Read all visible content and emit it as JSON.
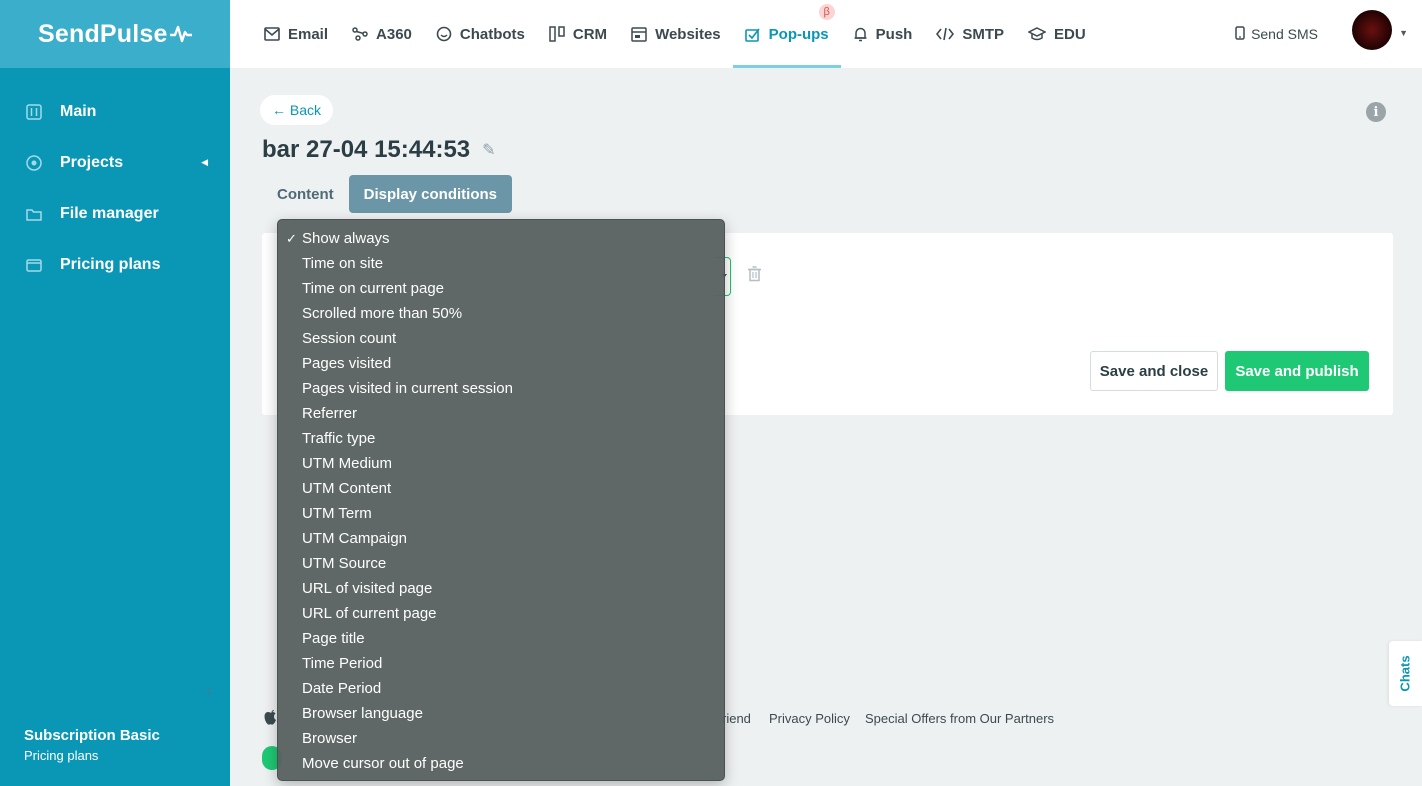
{
  "brand": {
    "name": "SendPulse"
  },
  "sidebar": {
    "items": [
      {
        "label": "Main",
        "icon": "main-icon"
      },
      {
        "label": "Projects",
        "icon": "projects-icon",
        "has_submenu": true
      },
      {
        "label": "File manager",
        "icon": "folder-icon"
      },
      {
        "label": "Pricing plans",
        "icon": "wallet-icon"
      }
    ],
    "plan_title": "Subscription Basic",
    "plan_link": "Pricing plans"
  },
  "topnav": {
    "items": [
      {
        "label": "Email",
        "icon": "mail-icon"
      },
      {
        "label": "A360",
        "icon": "nodes-icon"
      },
      {
        "label": "Chatbots",
        "icon": "chat-icon"
      },
      {
        "label": "CRM",
        "icon": "crm-icon"
      },
      {
        "label": "Websites",
        "icon": "website-icon"
      },
      {
        "label": "Pop-ups",
        "icon": "popup-icon",
        "active": true,
        "badge": "β"
      },
      {
        "label": "Push",
        "icon": "bell-icon"
      },
      {
        "label": "SMTP",
        "icon": "code-icon"
      },
      {
        "label": "EDU",
        "icon": "graduation-cap-icon"
      }
    ],
    "send_sms": "Send SMS"
  },
  "page": {
    "back_label": "← Back",
    "title": "bar 27-04 15:44:53",
    "tabs": [
      {
        "label": "Content",
        "active": false
      },
      {
        "label": "Display conditions",
        "active": true
      }
    ],
    "save_close": "Save and close",
    "save_publish": "Save and publish"
  },
  "dropdown": {
    "selected": "Show always",
    "options": [
      "Show always",
      "Time on site",
      "Time on current page",
      "Scrolled more than 50%",
      "Session count",
      "Pages visited",
      "Pages visited in current session",
      "Referrer",
      "Traffic type",
      "UTM Medium",
      "UTM Content",
      "UTM Term",
      "UTM Campaign",
      "UTM Source",
      "URL of visited page",
      "URL of current page",
      "Page title",
      "Time Period",
      "Date Period",
      "Browser language",
      "Browser",
      "Move cursor out of page"
    ]
  },
  "footer": {
    "links": [
      "riend",
      "Privacy Policy",
      "Special Offers from Our Partners"
    ]
  },
  "chats_label": "Chats",
  "colors": {
    "sidebar": "#0a97b6",
    "accent": "#0a97b6",
    "primary_button": "#1ec874",
    "active_tab": "#6b96a8"
  }
}
